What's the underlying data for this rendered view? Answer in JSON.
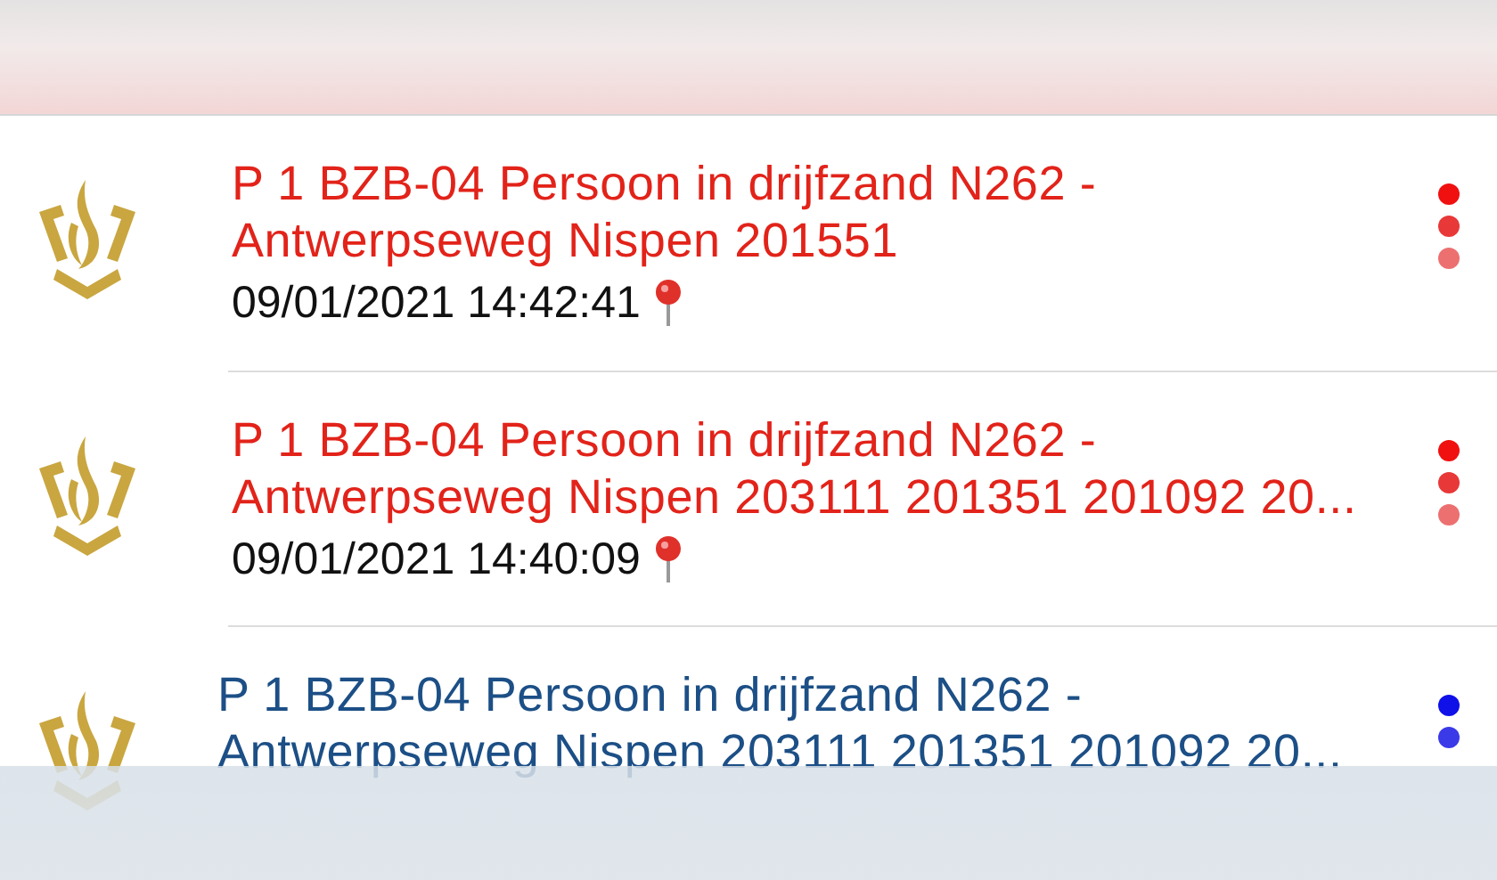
{
  "items": [
    {
      "title": "P 1 BZB-04 Persoon in drijfzand N262 - Antwerpseweg Nispen 201551",
      "time": "09/01/2021 14:42:41",
      "location": true,
      "color": "#e2231a",
      "dots": [
        {
          "color": "#f01010"
        },
        {
          "color": "#e83838"
        },
        {
          "color": "#ec7070"
        }
      ]
    },
    {
      "title": "P 1 BZB-04 Persoon in drijfzand N262 - Antwerpseweg Nispen 203111 201351 201092 20...",
      "time": "09/01/2021 14:40:09",
      "location": true,
      "color": "#e2231a",
      "dots": [
        {
          "color": "#f01010"
        },
        {
          "color": "#e83838"
        },
        {
          "color": "#ec7070"
        }
      ]
    },
    {
      "title": "P 1 BZB-04 Persoon in drijfzand N262 - Antwerpseweg Nispen 203111 201351 201092 20...",
      "color": "#1c4f86",
      "dots": [
        {
          "color": "#1010e8"
        },
        {
          "color": "#3a3ae8"
        }
      ]
    }
  ]
}
